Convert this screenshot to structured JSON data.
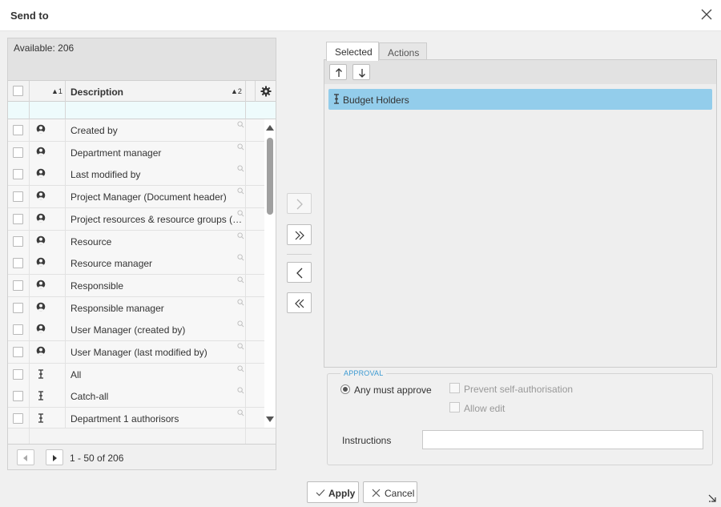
{
  "dialog": {
    "title": "Send to"
  },
  "available": {
    "label": "Available: 206"
  },
  "grid": {
    "sort_col1": "▲1",
    "header_description": "Description",
    "sort_col2": "▲2",
    "rows": [
      {
        "icon": "user-icon",
        "label": "Created by"
      },
      {
        "icon": "user-icon",
        "label": "Department manager"
      },
      {
        "icon": "user-icon",
        "label": "Last modified by"
      },
      {
        "icon": "user-icon",
        "label": "Project Manager (Document header)"
      },
      {
        "icon": "user-icon",
        "label": "Project resources & resource groups (D..."
      },
      {
        "icon": "user-icon",
        "label": "Resource"
      },
      {
        "icon": "user-icon",
        "label": "Resource manager"
      },
      {
        "icon": "user-icon",
        "label": "Responsible"
      },
      {
        "icon": "user-icon",
        "label": "Responsible manager"
      },
      {
        "icon": "user-icon",
        "label": "User Manager (created by)"
      },
      {
        "icon": "user-icon",
        "label": "User Manager (last modified by)"
      },
      {
        "icon": "group-icon",
        "label": "All"
      },
      {
        "icon": "group-icon",
        "label": "Catch-all"
      },
      {
        "icon": "group-icon",
        "label": "Department 1 authorisors"
      }
    ],
    "pager_text": "1 - 50 of 206"
  },
  "tabs": {
    "selected": "Selected",
    "actions": "Actions"
  },
  "selected_items": [
    {
      "icon": "group-icon",
      "label": "Budget Holders"
    }
  ],
  "approval": {
    "legend": "APPROVAL",
    "any_must_approve": "Any must approve",
    "prevent_self_auth": "Prevent self-authorisation",
    "allow_edit": "Allow edit",
    "instructions_label": "Instructions",
    "instructions_value": ""
  },
  "buttons": {
    "apply": "Apply",
    "cancel": "Cancel"
  }
}
